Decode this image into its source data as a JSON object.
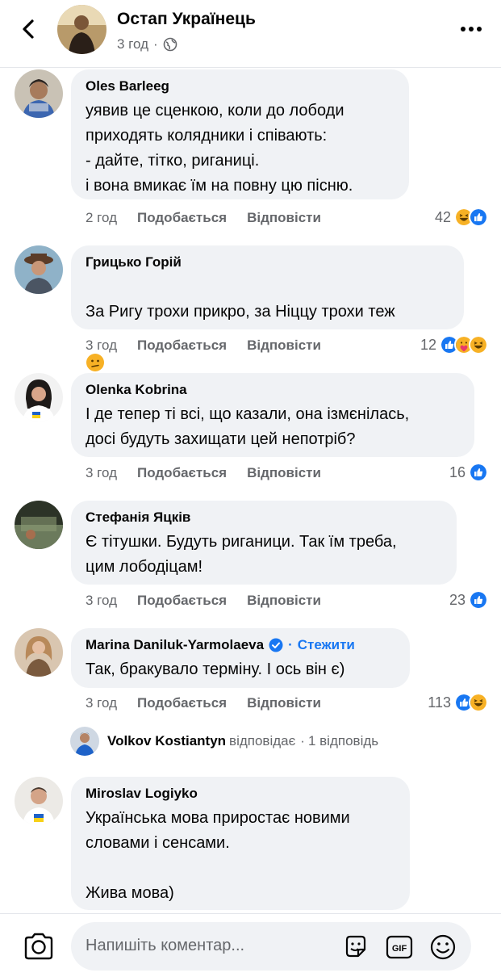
{
  "header": {
    "name": "Остап Українець",
    "time": "3 год",
    "separator": "·",
    "back_icon": "chevron-left-icon",
    "more_icon": "more-horizontal-icon"
  },
  "comments": [
    {
      "author": "Oles  Barleeg",
      "text": "уявив це сценкою, коли до лободи\nприходять колядники і співають:\n- дайте, тітко, риганиці.\nі вона вмикає їм на повну цю пісню.",
      "time": "2 год",
      "like": "Подобається",
      "reply": "Відповісти",
      "count": "42",
      "reactions": [
        "haha",
        "like"
      ]
    },
    {
      "author": "Грицько Горій",
      "text": "За Ригу трохи прикро, за Ніццу трохи теж",
      "emoji": "confused-face-icon",
      "time": "3 год",
      "like": "Подобається",
      "reply": "Відповісти",
      "count": "12",
      "reactions": [
        "like",
        "care",
        "haha"
      ]
    },
    {
      "author": "Olenka Kobrina",
      "text": "І де тепер ті всі, що казали, она ізмєнілась,\nдосі будуть захищати цей непотріб?",
      "time": "3 год",
      "like": "Подобається",
      "reply": "Відповісти",
      "count": "16",
      "reactions": [
        "like"
      ]
    },
    {
      "author": "Стефанія Яцків",
      "text": "Є тітушки. Будуть риганици. Так їм треба,\nцим лободіцам!",
      "time": "3 год",
      "like": "Подобається",
      "reply": "Відповісти",
      "count": "23",
      "reactions": [
        "like"
      ]
    },
    {
      "author": "Marina Daniluk-Yarmolaeva",
      "follow_sep": "·",
      "follow": "Стежити",
      "text": "Так, бракувало терміну. І ось він є)",
      "time": "3 год",
      "like": "Подобається",
      "reply": "Відповісти",
      "count": "113",
      "reactions": [
        "like",
        "haha"
      ]
    },
    {
      "author": "Miroslav Logiyko",
      "text": "Українська мова приростає новими\nсловами і сенсами.\n\nЖива мова)"
    }
  ],
  "reply_thread": {
    "name": "Volkov Kostiantyn",
    "action": "відповідає",
    "sep": "·",
    "count": "1 відповідь"
  },
  "composer": {
    "placeholder": "Напишіть коментар...",
    "camera_icon": "camera-icon",
    "sticker_icon": "sticker-icon",
    "gif_label": "GIF",
    "emoji_icon": "emoji-icon"
  },
  "colors": {
    "accent": "#1877f2",
    "bubble": "#f0f2f5",
    "secondary_text": "#65676b",
    "like_blue": "#1877f2",
    "haha_yellow": "#f7b125"
  }
}
